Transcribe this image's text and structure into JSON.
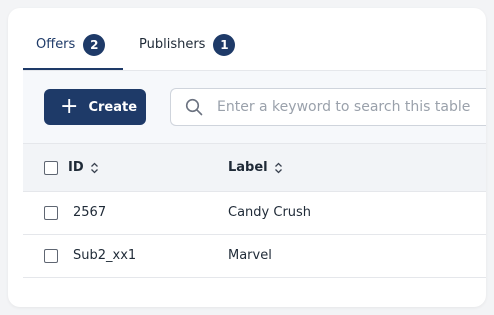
{
  "tabs": [
    {
      "label": "Offers",
      "count": "2"
    },
    {
      "label": "Publishers",
      "count": "1"
    }
  ],
  "toolbar": {
    "create_label": "Create",
    "search_placeholder": "Enter a keyword to search this table"
  },
  "table": {
    "columns": [
      "ID",
      "Label"
    ],
    "rows": [
      {
        "id": "2567",
        "label": "Candy Crush"
      },
      {
        "id": "Sub2_xx1",
        "label": "Marvel"
      }
    ]
  },
  "colors": {
    "accent": "#1e3a68",
    "header_bg": "#f2f4f7",
    "toolbar_bg": "#f6f8fb"
  },
  "icons": [
    "plus-icon",
    "search-icon",
    "sort-icon",
    "checkbox"
  ]
}
